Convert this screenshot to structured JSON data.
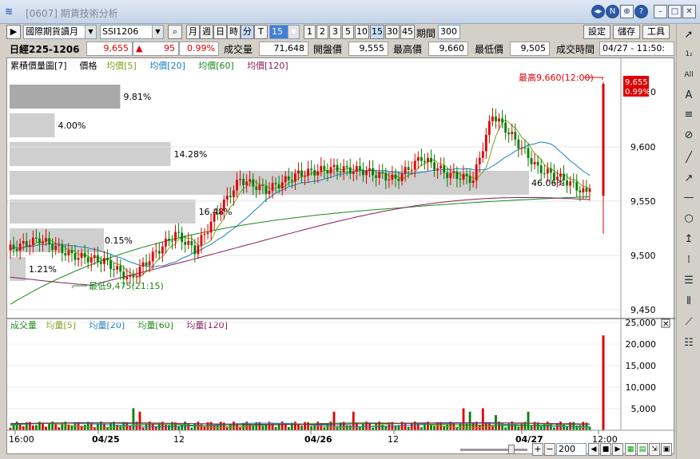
{
  "window": {
    "title": "[0607] 期貨技術分析",
    "buttons": [
      "◀▶",
      "N",
      "⊕",
      "?"
    ]
  },
  "toolbar": {
    "exchange": "國際期貨讀月",
    "symbol": "SSI1206",
    "period_buttons": [
      "月",
      "週",
      "日",
      "時",
      "分",
      "T"
    ],
    "interval": "15",
    "multipliers": [
      "1",
      "2",
      "3",
      "5",
      "10",
      "15",
      "30",
      "45"
    ],
    "period_label": "期間",
    "period_value": "300",
    "right_buttons": [
      "設定",
      "儲存",
      "工具"
    ]
  },
  "quote": {
    "name": "日經225-1206",
    "last": "9,655",
    "change": "95",
    "change_pct": "0.99%",
    "volume_label": "成交量",
    "volume": "71,648",
    "open_label": "開盤價",
    "open": "9,555",
    "high_label": "最高價",
    "high": "9,660",
    "low_label": "最低價",
    "low": "9,505",
    "time_label": "成交時間",
    "time": "04/27 - 11:50:"
  },
  "price_panel": {
    "legend": [
      {
        "text": "累積價量圖[7]",
        "color": "#000000"
      },
      {
        "text": "價格",
        "color": "#000000"
      },
      {
        "text": "均價[5]",
        "color": "#7ba61a"
      },
      {
        "text": "均價[20]",
        "color": "#1a7fc4"
      },
      {
        "text": "均價[60]",
        "color": "#1a8a1a"
      },
      {
        "text": "均價[120]",
        "color": "#8a1a5a"
      }
    ],
    "high_annotation": "最高9,660(12:00)",
    "low_annotation": "最低9,475(21:15)",
    "last_price_tag": "9,655",
    "last_pct_tag": "0.99%",
    "y_ticks": [
      "9,600",
      "9,550",
      "9,500",
      "9,450"
    ],
    "y_tick_partial": "0"
  },
  "volume_profile": [
    {
      "label": "9.81%",
      "value": 9.81
    },
    {
      "label": "4.00%",
      "value": 4.0
    },
    {
      "label": "14.28%",
      "value": 14.28
    },
    {
      "label": "46.06%",
      "value": 46.06
    },
    {
      "label": "16.48%",
      "value": 16.48
    },
    {
      "label": "0.15%",
      "value": 0.15
    },
    {
      "label": "1.21%",
      "value": 1.21
    }
  ],
  "volume_panel": {
    "legend": [
      {
        "text": "成交量",
        "color": "#1a8a1a"
      },
      {
        "text": "均量[5]",
        "color": "#7ba61a"
      },
      {
        "text": "均量[20]",
        "color": "#1a7fc4"
      },
      {
        "text": "均量[60]",
        "color": "#1a8a1a"
      },
      {
        "text": "均量[120]",
        "color": "#8a1a5a"
      }
    ],
    "y_ticks": [
      "25,000",
      "20,000",
      "15,000",
      "10,000",
      "5,000"
    ]
  },
  "x_axis": [
    "16:00",
    "04/25",
    "12",
    "04/26",
    "12",
    "04/27",
    "12:00"
  ],
  "zoom_value": "200",
  "colors": {
    "up": "#e00000",
    "down": "#008000",
    "accent": "#2b5aa8"
  }
}
